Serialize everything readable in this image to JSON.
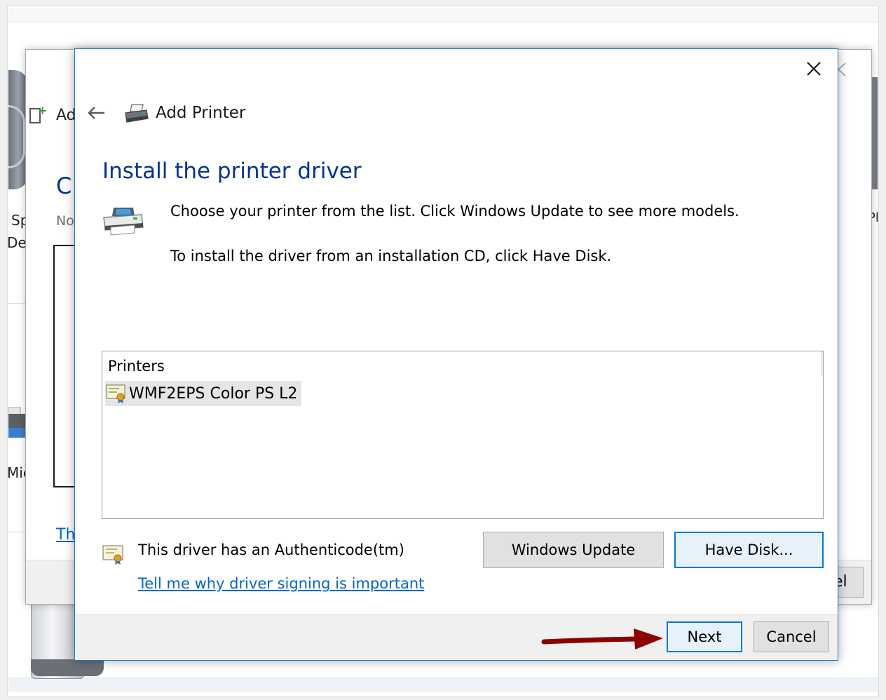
{
  "background": {
    "partial_texts": [
      "Ad",
      "C",
      "No",
      "Sp",
      "De",
      "Mic",
      "Th",
      "el",
      "Pl"
    ]
  },
  "dialog": {
    "title": "Add Printer",
    "heading": "Install the printer driver",
    "description_line1": "Choose your printer from the list. Click Windows Update to see more models.",
    "description_line2": "To install the driver from an installation CD, click Have Disk.",
    "list": {
      "header": "Printers",
      "items": [
        {
          "label": "WMF2EPS Color PS L2",
          "selected": true
        }
      ]
    },
    "signing_text": "This driver has an Authenticode(tm)",
    "signing_link": "Tell me why driver signing is important",
    "buttons": {
      "windows_update": "Windows Update",
      "have_disk": "Have Disk...",
      "next": "Next",
      "cancel": "Cancel"
    }
  },
  "colors": {
    "heading_blue": "#003399",
    "link_blue": "#0066cc",
    "accent_border": "#0078d7",
    "annotation_arrow": "#8b0000"
  },
  "icons": {
    "close": "close-icon",
    "back": "back-arrow-icon",
    "title": "printer-icon",
    "description": "printer-icon",
    "list_item": "certificate-icon",
    "signing": "certificate-icon"
  }
}
